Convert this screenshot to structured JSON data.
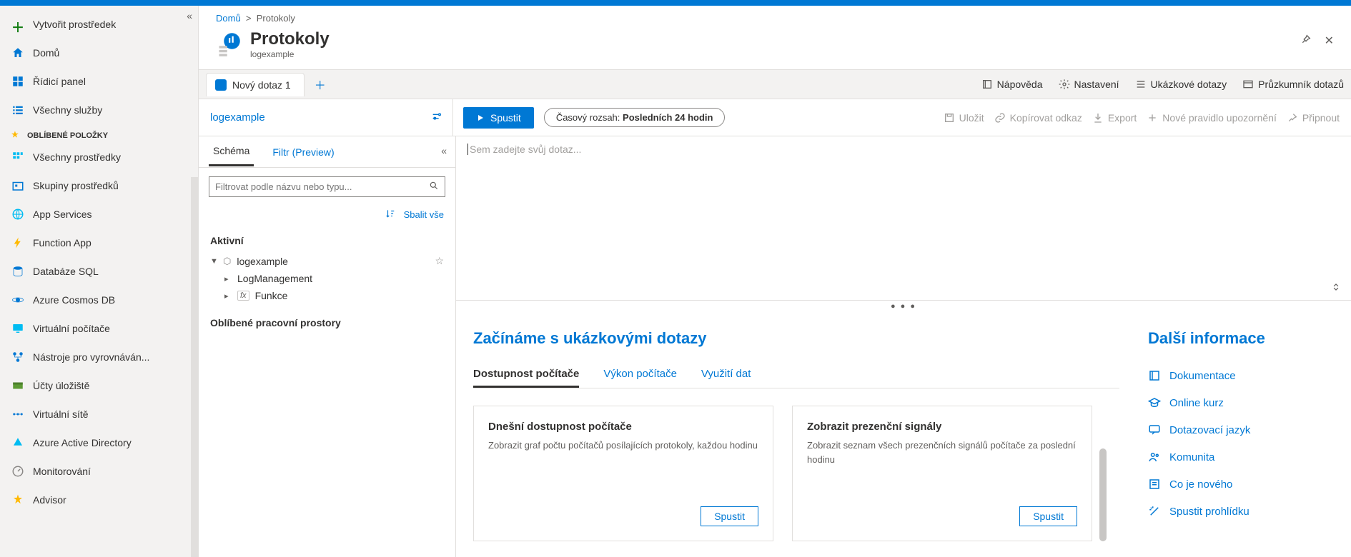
{
  "breadcrumb": {
    "home": "Domů",
    "current": "Protokoly"
  },
  "page": {
    "title": "Protokoly",
    "subtitle": "logexample"
  },
  "leftnav": {
    "create": "Vytvořit prostředek",
    "home": "Domů",
    "dashboard": "Řídicí panel",
    "allservices": "Všechny služby",
    "favorites_header": "OBLÍBENÉ POLOŽKY",
    "items": [
      "Všechny prostředky",
      "Skupiny prostředků",
      "App Services",
      "Function App",
      "Databáze SQL",
      "Azure Cosmos DB",
      "Virtuální počítače",
      "Nástroje pro vyrovnáván...",
      "Účty úložiště",
      "Virtuální sítě",
      "Azure Active Directory",
      "Monitorování",
      "Advisor"
    ]
  },
  "querytabs": {
    "first": "Nový dotaz 1"
  },
  "topcmds": {
    "help": "Nápověda",
    "settings": "Nastavení",
    "samples": "Ukázkové dotazy",
    "explorer": "Průzkumník dotazů"
  },
  "toolbar": {
    "workspace": "logexample",
    "run": "Spustit",
    "time_label": "Časový rozsah:",
    "time_value": "Posledních 24 hodin",
    "save": "Uložit",
    "copylink": "Kopírovat odkaz",
    "export": "Export",
    "newalert": "Nové pravidlo upozornění",
    "pin": "Připnout"
  },
  "schema": {
    "tab_schema": "Schéma",
    "tab_filter": "Filtr (Preview)",
    "filter_placeholder": "Filtrovat podle názvu nebo typu...",
    "collapse_all": "Sbalit vše",
    "active": "Aktivní",
    "workspace": "logexample",
    "child1": "LogManagement",
    "child2": "Funkce",
    "fav_ws": "Oblíbené pracovní prostory"
  },
  "editor": {
    "placeholder": "Sem zadejte svůj dotaz..."
  },
  "samples": {
    "heading": "Začínáme s ukázkovými dotazy",
    "tabs": [
      "Dostupnost počítače",
      "Výkon počítače",
      "Využití dat"
    ],
    "cards": [
      {
        "title": "Dnešní dostupnost počítače",
        "desc": "Zobrazit graf počtu počítačů posílajících protokoly, každou hodinu",
        "run": "Spustit"
      },
      {
        "title": "Zobrazit prezenční signály",
        "desc": "Zobrazit seznam všech prezenčních signálů počítače za poslední hodinu",
        "run": "Spustit"
      }
    ]
  },
  "moreinfo": {
    "heading": "Další informace",
    "links": [
      "Dokumentace",
      "Online kurz",
      "Dotazovací jazyk",
      "Komunita",
      "Co je nového",
      "Spustit prohlídku"
    ]
  }
}
